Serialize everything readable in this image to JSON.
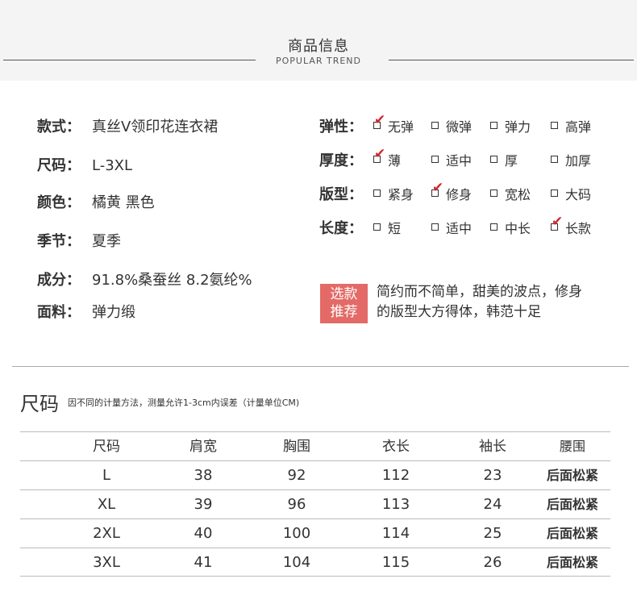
{
  "header": {
    "title": "商品信息",
    "subtitle": "POPULAR TREND"
  },
  "info": [
    {
      "key": "款式：",
      "value": "真丝V领印花连衣裙"
    },
    {
      "key": "尺码：",
      "value": "L-3XL"
    },
    {
      "key": "颜色：",
      "value": "橘黄 黑色"
    },
    {
      "key": "季节：",
      "value": "夏季"
    },
    {
      "key": "成分：",
      "value": "91.8%桑蚕丝 8.2氨纶%"
    },
    {
      "key": "面料：",
      "value": "弹力缎"
    }
  ],
  "attributes": [
    {
      "key": "弹性：",
      "options": [
        {
          "label": "无弹",
          "checked": true
        },
        {
          "label": "微弹",
          "checked": false
        },
        {
          "label": "弹力",
          "checked": false
        },
        {
          "label": "高弹",
          "checked": false
        }
      ]
    },
    {
      "key": "厚度：",
      "options": [
        {
          "label": "薄",
          "checked": true
        },
        {
          "label": "适中",
          "checked": false
        },
        {
          "label": "厚",
          "checked": false
        },
        {
          "label": "加厚",
          "checked": false
        }
      ]
    },
    {
      "key": "版型：",
      "options": [
        {
          "label": "紧身",
          "checked": false
        },
        {
          "label": "修身",
          "checked": true
        },
        {
          "label": "宽松",
          "checked": false
        },
        {
          "label": "大码",
          "checked": false
        }
      ]
    },
    {
      "key": "长度：",
      "options": [
        {
          "label": "短",
          "checked": false
        },
        {
          "label": "适中",
          "checked": false
        },
        {
          "label": "中长",
          "checked": false
        },
        {
          "label": "长款",
          "checked": true
        }
      ]
    }
  ],
  "recommend": {
    "badge_line1": "选款",
    "badge_line2": "推荐",
    "line1": "简约而不简单，甜美的波点，修身",
    "line2": "的版型大方得体，韩范十足",
    "badge_color": "#e36a66"
  },
  "size_chart": {
    "title": "尺码",
    "note": "因不同的计量方法，测量允许1-3cm内误差（计量单位CM)",
    "headers": [
      "尺码",
      "肩宽",
      "胸围",
      "衣长",
      "袖长",
      "腰围"
    ],
    "rows": [
      [
        "L",
        "38",
        "92",
        "112",
        "23",
        "后面松紧"
      ],
      [
        "XL",
        "39",
        "96",
        "113",
        "24",
        "后面松紧"
      ],
      [
        "2XL",
        "40",
        "100",
        "114",
        "25",
        "后面松紧"
      ],
      [
        "3XL",
        "41",
        "104",
        "115",
        "26",
        "后面松紧"
      ]
    ]
  },
  "check_color": "#d0262e"
}
